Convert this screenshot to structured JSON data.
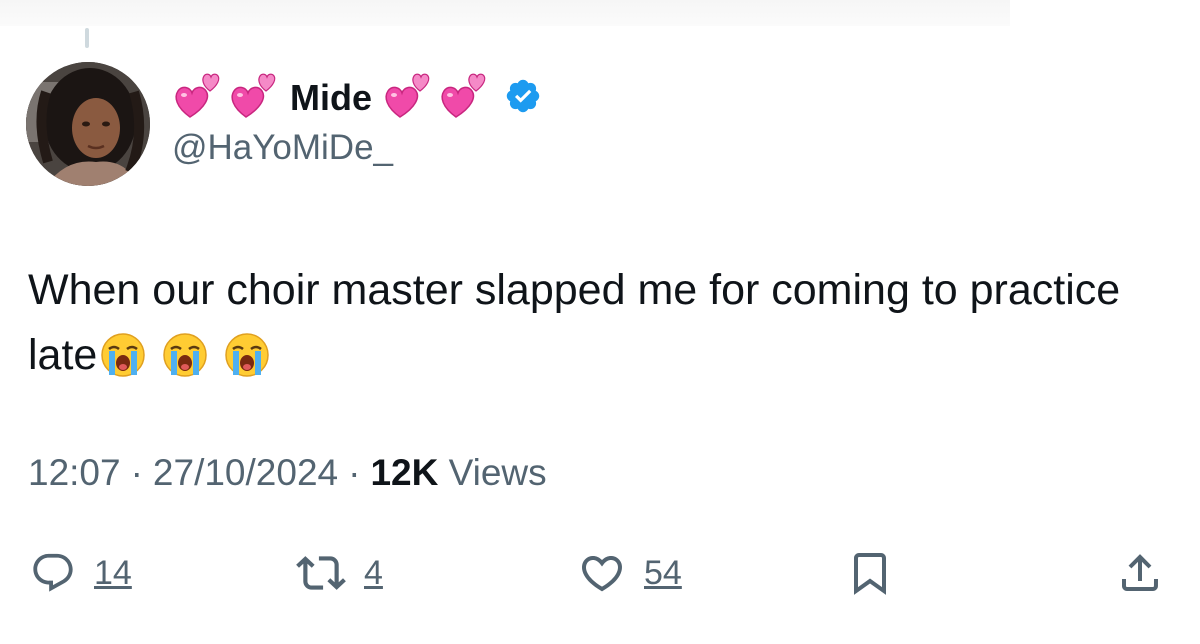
{
  "author": {
    "display_name": "Mide",
    "handle": "@HaYoMiDe_",
    "name_decoration_icons": [
      "revolving-hearts-emoji",
      "revolving-hearts-emoji",
      "revolving-hearts-emoji",
      "revolving-hearts-emoji"
    ],
    "verified": true,
    "verified_color": "#1d9bf0"
  },
  "tweet": {
    "text": "When our choir master slapped me for coming to practice late",
    "trailing_emojis": [
      "loudly-crying-face-emoji",
      "loudly-crying-face-emoji",
      "loudly-crying-face-emoji"
    ]
  },
  "meta": {
    "time": "12:07",
    "separator": "·",
    "date": "27/10/2024",
    "views_count": "12K",
    "views_label": "Views"
  },
  "actions": {
    "reply_count": "14",
    "retweet_count": "4",
    "like_count": "54"
  },
  "colors": {
    "text_primary": "#0f1419",
    "text_secondary": "#536471",
    "heart_pink": "#f04aa9"
  }
}
